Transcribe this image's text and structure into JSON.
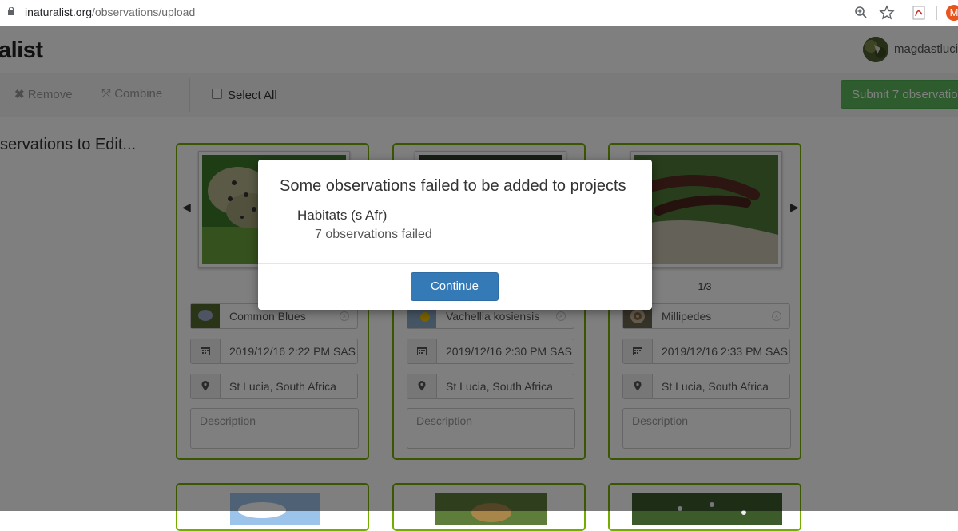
{
  "browser": {
    "url_host": "inaturalist.org",
    "url_path": "/observations/upload",
    "profile_initial": "M"
  },
  "header": {
    "logo_text": "alist",
    "username": "magdastluci"
  },
  "toolbar": {
    "remove_label": "Remove",
    "combine_label": "Combine",
    "select_all_label": "Select All",
    "submit_label": "Submit 7 observatio"
  },
  "main": {
    "title": "servations to Edit..."
  },
  "cards": [
    {
      "species": "Common Blues",
      "datetime": "2019/12/16 2:22 PM SAS",
      "location": "St Lucia, South Africa",
      "description_placeholder": "Description"
    },
    {
      "species": "Vachellia kosiensis",
      "datetime": "2019/12/16 2:30 PM SAS",
      "location": "St Lucia, South Africa",
      "description_placeholder": "Description"
    },
    {
      "species": "Millipedes",
      "datetime": "2019/12/16 2:33 PM SAS",
      "location": "St Lucia, South Africa",
      "description_placeholder": "Description",
      "photo_counter": "1/3"
    }
  ],
  "modal": {
    "title": "Some observations failed to be added to projects",
    "project_name": "Habitats (s Afr)",
    "failed_text": "7 observations failed",
    "continue_label": "Continue"
  },
  "colors": {
    "card_border": "#74ac00",
    "submit_green": "#5cb85c",
    "continue_blue": "#337ab7"
  }
}
